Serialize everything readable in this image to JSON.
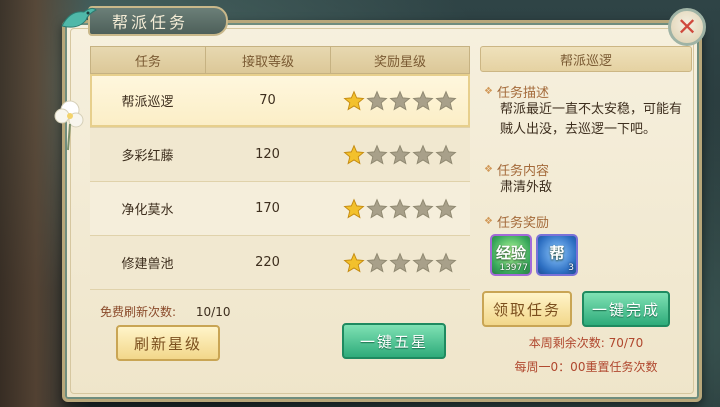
{
  "window": {
    "title": "帮派任务",
    "close_label": "✕"
  },
  "table": {
    "headers": [
      "任务",
      "接取等级",
      "奖励星级"
    ],
    "rows": [
      {
        "name": "帮派巡逻",
        "level": "70",
        "stars": 1,
        "max_stars": 5
      },
      {
        "name": "多彩红藤",
        "level": "120",
        "stars": 1,
        "max_stars": 5
      },
      {
        "name": "净化莫水",
        "level": "170",
        "stars": 1,
        "max_stars": 5
      },
      {
        "name": "修建兽池",
        "level": "220",
        "stars": 1,
        "max_stars": 5
      }
    ],
    "selected_index": 0
  },
  "refresh": {
    "label": "免费刷新次数:",
    "count": "10/10",
    "refresh_button": "刷新星级",
    "five_star_button": "一键五星"
  },
  "detail": {
    "title": "帮派巡逻",
    "desc_label": "任务描述",
    "desc_text": "帮派最近一直不太安稳，可能有贼人出没，去巡逻一下吧。",
    "content_label": "任务内容",
    "content_text": "肃清外敌",
    "reward_label": "任务奖励",
    "rewards": [
      {
        "glyph": "经验",
        "qty": "13977",
        "icon": "exp-icon"
      },
      {
        "glyph": "帮",
        "qty": "3",
        "icon": "guild-contribution-icon"
      }
    ],
    "accept_button": "领取任务",
    "complete_button": "一键完成",
    "weekly_remaining": "本周剩余次数: 70/70",
    "weekly_reset": "每周一0：00重置任务次数"
  },
  "colors": {
    "panel_bg": "#f6f0de",
    "accent_green": "#2eab7a",
    "accent_gold": "#f2d78a",
    "warning_red": "#b0472e",
    "star_gold": "#f3c12c",
    "star_empty": "#a8a08a"
  }
}
